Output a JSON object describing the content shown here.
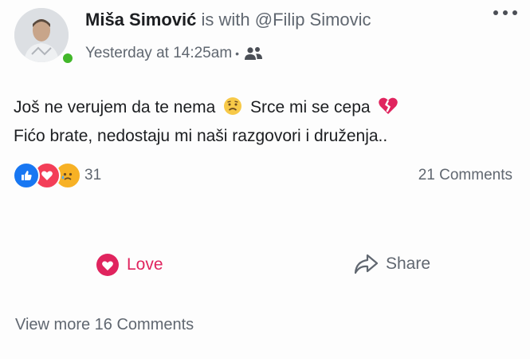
{
  "post": {
    "author": "Miša Simović",
    "with_text": "is with",
    "with_target": "@Filip Simovic",
    "timestamp": "Yesterday at 14:25am",
    "audience_icon": "friends-icon",
    "text_line1_a": "Još ne verujem da te nema",
    "text_line1_b": "Srce mi se cepa",
    "text_line2": "Fićo brate, nedostaju mi naši razgovori i druženja..",
    "inline_emojis": [
      "sad-face-emoji",
      "broken-heart-emoji"
    ]
  },
  "reactions": {
    "types": [
      "like",
      "love",
      "sad"
    ],
    "count": "31"
  },
  "comments": {
    "count_label": "21 Comments",
    "view_more_label": "View more 16 Comments"
  },
  "actions": {
    "love_label": "Love",
    "share_label": "Share"
  },
  "colors": {
    "like": "#1877f2",
    "love": "#f33e58",
    "sad": "#f7b125",
    "online": "#42b72a",
    "meta_text": "#606770",
    "love_action": "#e0245e"
  }
}
